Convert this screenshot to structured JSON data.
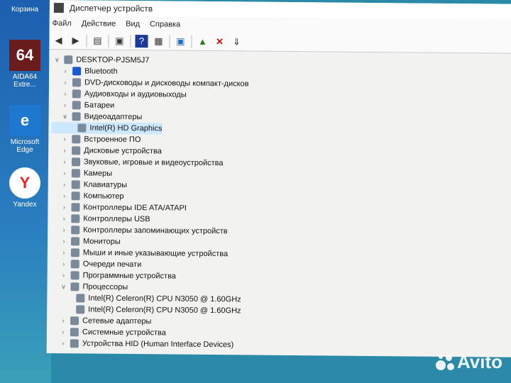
{
  "desktop": {
    "icons": [
      {
        "label": "Корзина"
      },
      {
        "label": "AIDA64 Extre...",
        "glyph": "64"
      },
      {
        "label": "Microsoft Edge",
        "glyph": "e"
      },
      {
        "label": "Yandex",
        "glyph": "Y"
      }
    ]
  },
  "window": {
    "title": "Диспетчер устройств"
  },
  "menu": [
    "Файл",
    "Действие",
    "Вид",
    "Справка"
  ],
  "toolbar": [
    "back-icon",
    "forward-icon",
    "console-tree-icon",
    "properties-icon",
    "help-icon",
    "view-icon",
    "scan-monitor-icon",
    "update-driver-icon",
    "uninstall-icon",
    "download-icon"
  ],
  "tree": [
    {
      "label": "DESKTOP-PJSM5J7",
      "level": 0,
      "expanded": true
    },
    {
      "label": "Bluetooth",
      "level": 1
    },
    {
      "label": "DVD-дисководы и дисководы компакт-дисков",
      "level": 1
    },
    {
      "label": "Аудиовходы и аудиовыходы",
      "level": 1
    },
    {
      "label": "Батареи",
      "level": 1
    },
    {
      "label": "Видеоадаптеры",
      "level": 1,
      "expanded": true
    },
    {
      "label": "Intel(R) HD Graphics",
      "level": 2,
      "selected": true
    },
    {
      "label": "Встроенное ПО",
      "level": 1
    },
    {
      "label": "Дисковые устройства",
      "level": 1
    },
    {
      "label": "Звуковые, игровые и видеоустройства",
      "level": 1
    },
    {
      "label": "Камеры",
      "level": 1
    },
    {
      "label": "Клавиатуры",
      "level": 1
    },
    {
      "label": "Компьютер",
      "level": 1
    },
    {
      "label": "Контроллеры IDE ATA/ATAPI",
      "level": 1
    },
    {
      "label": "Контроллеры USB",
      "level": 1
    },
    {
      "label": "Контроллеры запоминающих устройств",
      "level": 1
    },
    {
      "label": "Мониторы",
      "level": 1
    },
    {
      "label": "Мыши и иные указывающие устройства",
      "level": 1
    },
    {
      "label": "Очереди печати",
      "level": 1
    },
    {
      "label": "Программные устройства",
      "level": 1
    },
    {
      "label": "Процессоры",
      "level": 1,
      "expanded": true
    },
    {
      "label": "Intel(R) Celeron(R) CPU  N3050  @ 1.60GHz",
      "level": 2
    },
    {
      "label": "Intel(R) Celeron(R) CPU  N3050  @ 1.60GHz",
      "level": 2
    },
    {
      "label": "Сетевые адаптеры",
      "level": 1
    },
    {
      "label": "Системные устройства",
      "level": 1
    },
    {
      "label": "Устройства HID (Human Interface Devices)",
      "level": 1
    }
  ],
  "watermark": "Avito"
}
